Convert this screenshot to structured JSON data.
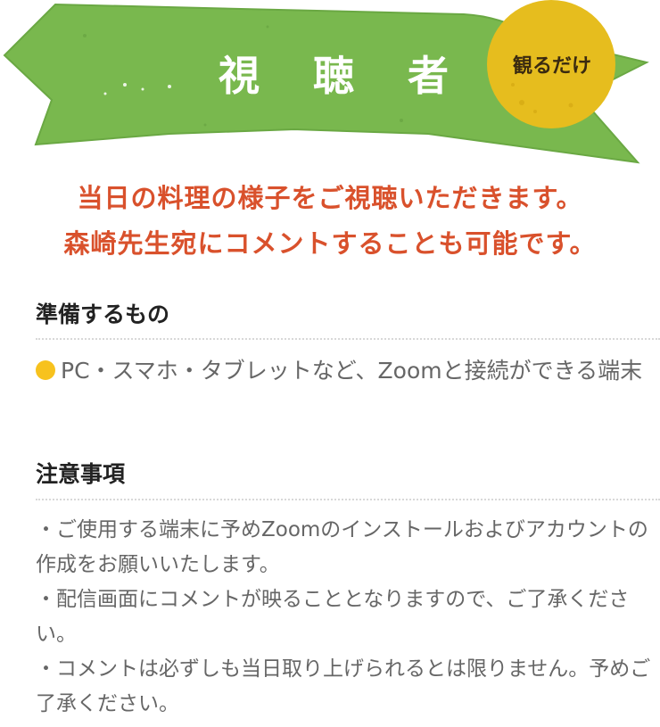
{
  "banner": {
    "title": "視 聴 者",
    "badge": "観るだけ"
  },
  "lead": {
    "line1": "当日の料理の様子をご視聴いただきます。",
    "line2": "森崎先生宛にコメントすることも可能です。"
  },
  "prepare": {
    "heading": "準備するもの",
    "item": "PC・スマホ・タブレットなど、Zoomと接続ができる端末"
  },
  "notes": {
    "heading": "注意事項",
    "items": [
      "・ご使用する端末に予めZoomのインストールおよびアカウントの作成をお願いいたします。",
      "・配信画面にコメントが映ることとなりますので、ご了承ください。",
      "・コメントは必ずしも当日取り上げられるとは限りません。予めご了承ください。"
    ]
  },
  "colors": {
    "banner_green": "#79b84e",
    "badge_yellow": "#e6bd1e",
    "lead_red": "#d9512c",
    "bullet_yellow": "#f7c21e"
  }
}
